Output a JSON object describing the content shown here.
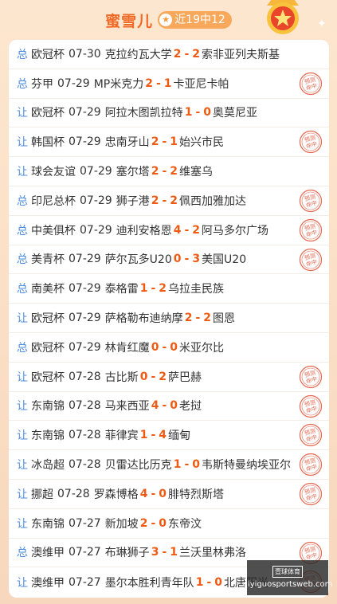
{
  "header": {
    "title": "蜜雪儿",
    "record": "近19中12",
    "record_icon": "star-icon"
  },
  "stamp_text": "预测命中",
  "colors": {
    "accent": "#ef5a12",
    "type_blue": "#4e8de0",
    "stamp_red": "#e3684f"
  },
  "matches": [
    {
      "type": "总",
      "league": "欧冠杯",
      "date": "07-30",
      "home": "克拉约瓦大学",
      "hs": "2",
      "sep": "-",
      "as": "2",
      "away": "索非亚列夫斯基",
      "hit": false
    },
    {
      "type": "总",
      "league": "芬甲",
      "date": "07-29",
      "home": "MP米克力",
      "hs": "2",
      "sep": "-",
      "as": "1",
      "away": "卡亚尼卡帕",
      "hit": true
    },
    {
      "type": "让",
      "league": "欧冠杯",
      "date": "07-29",
      "home": "阿拉木图凯拉特",
      "hs": "1",
      "sep": "-",
      "as": "0",
      "away": "奥莫尼亚",
      "hit": false
    },
    {
      "type": "让",
      "league": "韩国杯",
      "date": "07-29",
      "home": "忠南牙山",
      "hs": "2",
      "sep": "-",
      "as": "1",
      "away": "始兴市民",
      "hit": true
    },
    {
      "type": "让",
      "league": "球会友谊",
      "date": "07-29",
      "home": "塞尔塔",
      "hs": "2",
      "sep": "-",
      "as": "2",
      "away": "维塞乌",
      "hit": false
    },
    {
      "type": "总",
      "league": "印尼总杯",
      "date": "07-29",
      "home": "狮子港",
      "hs": "2",
      "sep": "-",
      "as": "2",
      "away": "佩西加雅加达",
      "hit": true
    },
    {
      "type": "总",
      "league": "中美俱杯",
      "date": "07-29",
      "home": "迪利安格恩",
      "hs": "4",
      "sep": "-",
      "as": "2",
      "away": "阿马多尔广场",
      "hit": true
    },
    {
      "type": "总",
      "league": "美青杯",
      "date": "07-29",
      "home": "萨尔瓦多U20",
      "hs": "0",
      "sep": "-",
      "as": "3",
      "away": "美国U20",
      "hit": true
    },
    {
      "type": "总",
      "league": "南美杯",
      "date": "07-29",
      "home": "泰格雷",
      "hs": "1",
      "sep": "-",
      "as": "2",
      "away": "乌拉圭民族",
      "hit": false
    },
    {
      "type": "让",
      "league": "欧冠杯",
      "date": "07-29",
      "home": "萨格勒布迪纳摩",
      "hs": "2",
      "sep": "-",
      "as": "2",
      "away": "图恩",
      "hit": false
    },
    {
      "type": "总",
      "league": "欧冠杯",
      "date": "07-29",
      "home": "林肯红魔",
      "hs": "0",
      "sep": "-",
      "as": "0",
      "away": "米亚尔比",
      "hit": false
    },
    {
      "type": "让",
      "league": "欧冠杯",
      "date": "07-28",
      "home": "古比斯",
      "hs": "0",
      "sep": "-",
      "as": "2",
      "away": "萨巴赫",
      "hit": true
    },
    {
      "type": "让",
      "league": "东南锦",
      "date": "07-28",
      "home": "马来西亚",
      "hs": "4",
      "sep": "-",
      "as": "0",
      "away": "老挝",
      "hit": true
    },
    {
      "type": "让",
      "league": "东南锦",
      "date": "07-28",
      "home": "菲律宾",
      "hs": "1",
      "sep": "-",
      "as": "4",
      "away": "缅甸",
      "hit": true
    },
    {
      "type": "让",
      "league": "冰岛超",
      "date": "07-28",
      "home": "贝雷达比历克",
      "hs": "1",
      "sep": "-",
      "as": "0",
      "away": "韦斯特曼纳埃亚尔",
      "hit": true
    },
    {
      "type": "让",
      "league": "挪超",
      "date": "07-28",
      "home": "罗森博格",
      "hs": "4",
      "sep": "-",
      "as": "0",
      "away": "腓特烈斯塔",
      "hit": true
    },
    {
      "type": "让",
      "league": "东南锦",
      "date": "07-27",
      "home": "新加坡",
      "hs": "2",
      "sep": "-",
      "as": "0",
      "away": "东帝汶",
      "hit": false
    },
    {
      "type": "总",
      "league": "澳维甲",
      "date": "07-27",
      "home": "布琳狮子",
      "hs": "3",
      "sep": "-",
      "as": "1",
      "away": "兰沃里林弗洛",
      "hit": true
    },
    {
      "type": "让",
      "league": "澳维甲",
      "date": "07-27",
      "home": "墨尔本胜利青年队",
      "hs": "1",
      "sep": "-",
      "as": "0",
      "away": "北唐阳光",
      "hit": true
    }
  ],
  "watermark": {
    "logo": "壹球体育",
    "url": "qiyiguosportsweb.com"
  }
}
